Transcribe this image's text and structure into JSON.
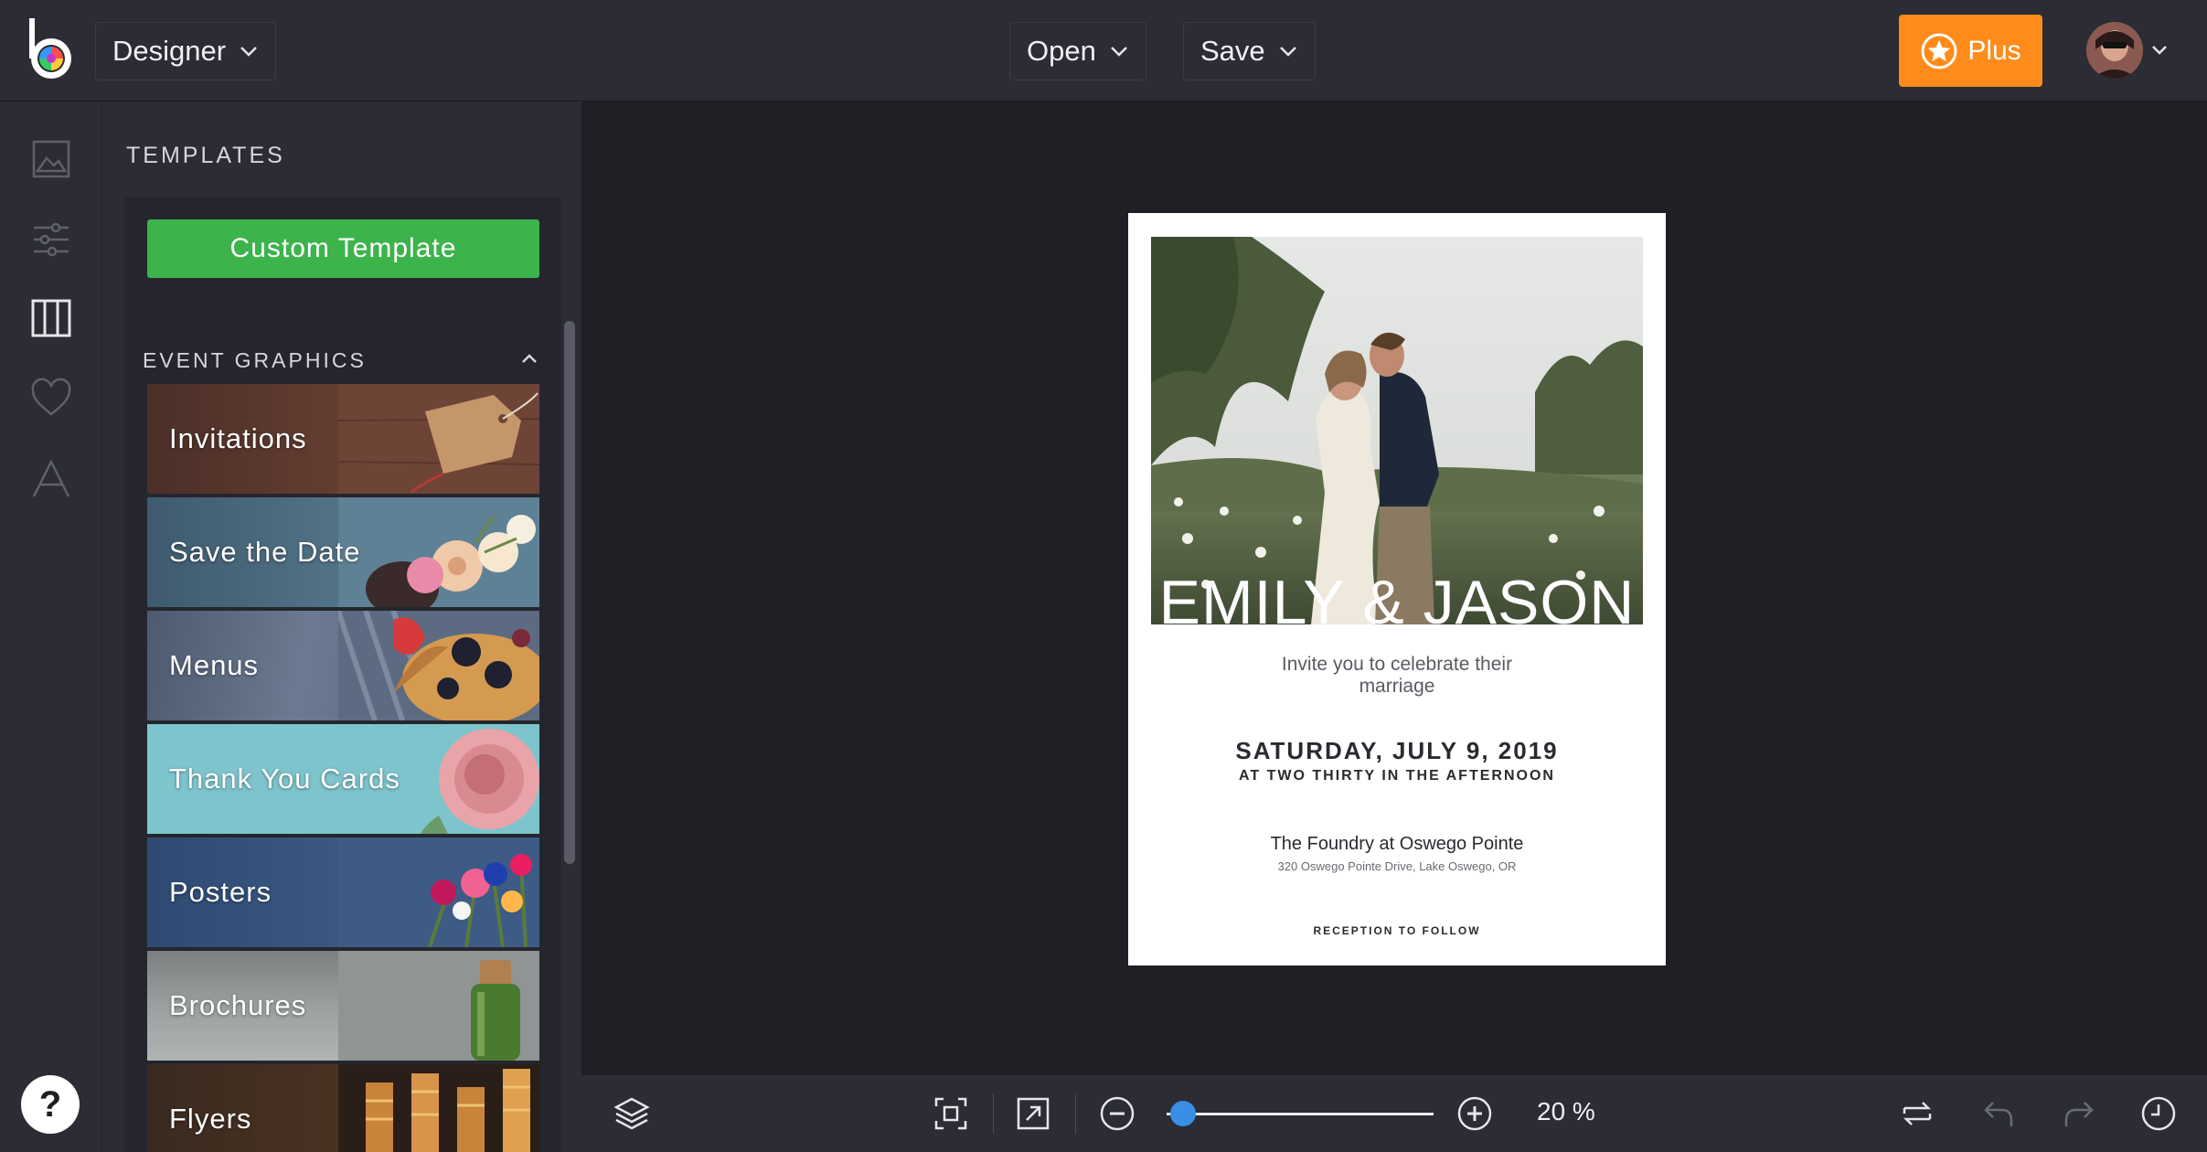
{
  "header": {
    "mode_label": "Designer",
    "open_label": "Open",
    "save_label": "Save",
    "plus_label": "Plus"
  },
  "rail": {
    "icons": [
      "image-icon",
      "adjustments-icon",
      "templates-icon",
      "favorites-icon",
      "text-icon"
    ],
    "help_label": "?"
  },
  "templates": {
    "title": "TEMPLATES",
    "custom_template_label": "Custom Template",
    "group_title": "EVENT GRAPHICS",
    "items": [
      {
        "label": "Invitations"
      },
      {
        "label": "Save the Date"
      },
      {
        "label": "Menus"
      },
      {
        "label": "Thank You Cards"
      },
      {
        "label": "Posters"
      },
      {
        "label": "Brochures"
      },
      {
        "label": "Flyers"
      }
    ]
  },
  "design": {
    "names": "EMILY & JASON",
    "invite_line1": "Invite you to celebrate their",
    "invite_line2": "marriage",
    "date": "SATURDAY, JULY 9, 2019",
    "time": "AT TWO THIRTY IN THE AFTERNOON",
    "venue": "The Foundry at Oswego Pointe",
    "address": "320 Oswego Pointe Drive, Lake Oswego, OR",
    "reception": "RECEPTION TO FOLLOW"
  },
  "bottombar": {
    "zoom_label": "20 %",
    "zoom_level": 0.02
  },
  "colors": {
    "accent_orange": "#ff8c1a",
    "accent_green": "#3cb44b",
    "slider_blue": "#3a8ee6",
    "panel_bg": "#2b2c34",
    "canvas_bg": "#1f2025"
  }
}
